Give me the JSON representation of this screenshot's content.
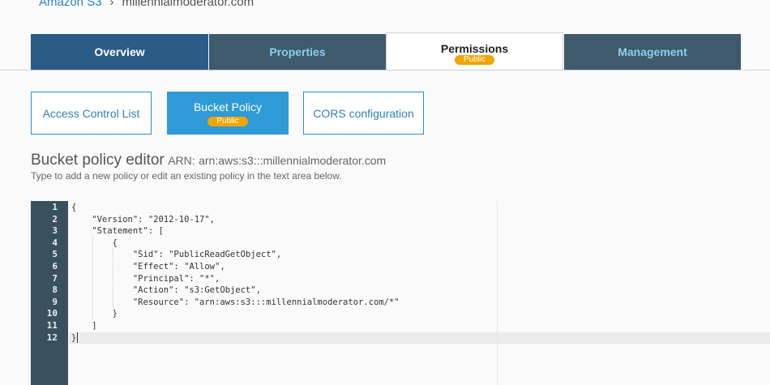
{
  "breadcrumb": {
    "root": "Amazon S3",
    "separator": "›",
    "current": "millennialmoderator.com"
  },
  "tabs": [
    {
      "label": "Overview",
      "active": false
    },
    {
      "label": "Properties",
      "active": false
    },
    {
      "label": "Permissions",
      "active": true,
      "badge": "Public"
    },
    {
      "label": "Management",
      "active": false
    }
  ],
  "subtabs": [
    {
      "label": "Access Control List",
      "active": false
    },
    {
      "label": "Bucket Policy",
      "active": true,
      "badge": "Public"
    },
    {
      "label": "CORS configuration",
      "active": false
    }
  ],
  "editor": {
    "title": "Bucket policy editor",
    "arn_label": "ARN:",
    "arn_value": "arn:aws:s3:::millennialmoderator.com",
    "help": "Type to add a new policy or edit an existing policy in the text area below."
  },
  "code": {
    "line_numbers": [
      "1",
      "2",
      "3",
      "4",
      "5",
      "6",
      "7",
      "8",
      "9",
      "10",
      "11",
      "12"
    ],
    "lines": [
      "{",
      "    \"Version\": \"2012-10-17\",",
      "    \"Statement\": [",
      "        {",
      "            \"Sid\": \"PublicReadGetObject\",",
      "            \"Effect\": \"Allow\",",
      "            \"Principal\": \"*\",",
      "            \"Action\": \"s3:GetObject\",",
      "            \"Resource\": \"arn:aws:s3:::millennialmoderator.com/*\"",
      "        }",
      "    ]",
      "}"
    ],
    "active_line": 12
  },
  "colors": {
    "tab_overview": "#2b5b87",
    "tab_slate": "#3e5a6c",
    "accent_blue": "#2e9ad6",
    "badge_orange": "#f0a500",
    "gutter": "#39505f"
  }
}
